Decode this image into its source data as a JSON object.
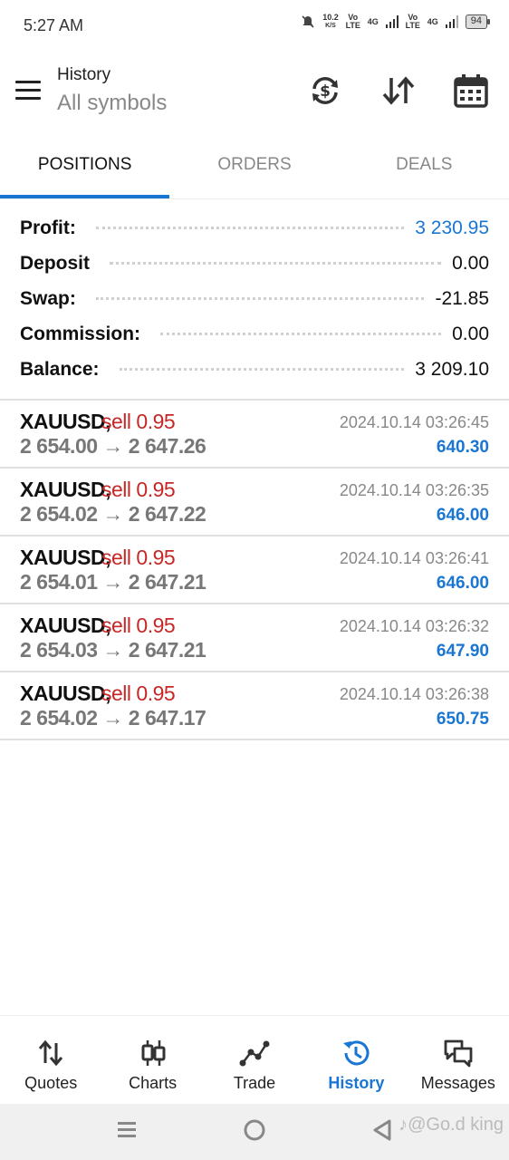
{
  "status_bar": {
    "time": "5:27 AM",
    "net_speed": "10.2",
    "net_unit": "K/S",
    "sim1_tag": "Vo LTE",
    "sim1_net": "4G",
    "sim2_tag": "Vo LTE",
    "sim2_net": "4G",
    "battery": "94"
  },
  "header": {
    "title": "History",
    "subtitle": "All symbols"
  },
  "tabs": [
    {
      "label": "POSITIONS",
      "active": true
    },
    {
      "label": "ORDERS",
      "active": false
    },
    {
      "label": "DEALS",
      "active": false
    }
  ],
  "summary": [
    {
      "label": "Profit:",
      "value": "3 230.95"
    },
    {
      "label": "Deposit",
      "value": "0.00"
    },
    {
      "label": "Swap:",
      "value": "-21.85"
    },
    {
      "label": "Commission:",
      "value": "0.00"
    },
    {
      "label": "Balance:",
      "value": "3 209.10"
    }
  ],
  "positions": [
    {
      "symbol": "XAUUSD,",
      "type": "sell 0.95",
      "prices": "2 654.00 → 2 647.26",
      "time": "2024.10.14 03:26:45",
      "profit": "640.30"
    },
    {
      "symbol": "XAUUSD,",
      "type": "sell 0.95",
      "prices": "2 654.02 → 2 647.22",
      "time": "2024.10.14 03:26:35",
      "profit": "646.00"
    },
    {
      "symbol": "XAUUSD,",
      "type": "sell 0.95",
      "prices": "2 654.01 → 2 647.21",
      "time": "2024.10.14 03:26:41",
      "profit": "646.00"
    },
    {
      "symbol": "XAUUSD,",
      "type": "sell 0.95",
      "prices": "2 654.03 → 2 647.21",
      "time": "2024.10.14 03:26:32",
      "profit": "647.90"
    },
    {
      "symbol": "XAUUSD,",
      "type": "sell 0.95",
      "prices": "2 654.02 → 2 647.17",
      "time": "2024.10.14 03:26:38",
      "profit": "650.75"
    }
  ],
  "bottom_nav": [
    {
      "label": "Quotes",
      "icon": "quotes-arrows-icon",
      "active": false
    },
    {
      "label": "Charts",
      "icon": "candlestick-icon",
      "active": false
    },
    {
      "label": "Trade",
      "icon": "trade-line-icon",
      "active": false
    },
    {
      "label": "History",
      "icon": "history-clock-icon",
      "active": true
    },
    {
      "label": "Messages",
      "icon": "chat-bubbles-icon",
      "active": false
    }
  ],
  "watermark": "♪@Go.d king",
  "colors": {
    "accent": "#1976d2",
    "sell": "#c62828",
    "muted": "#888888"
  }
}
